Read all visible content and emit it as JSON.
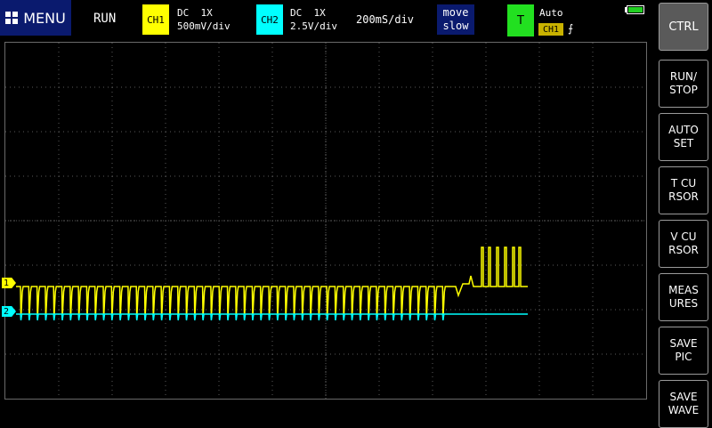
{
  "header": {
    "menu_label": "MENU",
    "run_status": "RUN",
    "ch1": {
      "tag": "CH1",
      "coupling": "DC  1X",
      "scale": "500mV/div",
      "color": "#ffff00"
    },
    "ch2": {
      "tag": "CH2",
      "coupling": "DC  1X",
      "scale": "2.5V/div",
      "color": "#00ffff"
    },
    "timebase": "200mS/div",
    "move": {
      "line1": "move",
      "line2": "slow"
    },
    "trigger": {
      "tag": "T",
      "mode": "Auto",
      "source": "CH1",
      "edge": "⨍",
      "color": "#22e020"
    },
    "battery_icon": "battery-icon"
  },
  "markers": {
    "ch1": "1",
    "ch2": "2"
  },
  "side_buttons": [
    {
      "id": "ctrl",
      "label": "CTRL"
    },
    {
      "id": "run-stop",
      "label": "RUN/\nSTOP"
    },
    {
      "id": "auto-set",
      "label": "AUTO\nSET"
    },
    {
      "id": "t-cursor",
      "label": "T CU\nRSOR"
    },
    {
      "id": "v-cursor",
      "label": "V CU\nRSOR"
    },
    {
      "id": "measures",
      "label": "MEAS\nURES"
    },
    {
      "id": "save-pic",
      "label": "SAVE\nPIC"
    },
    {
      "id": "save-wave",
      "label": "SAVE\nWAVE"
    }
  ],
  "colors": {
    "grid": "#5a5a5a",
    "ch1": "#ffff00",
    "ch2": "#00ffff",
    "menu_bg": "#0a1a6e"
  }
}
